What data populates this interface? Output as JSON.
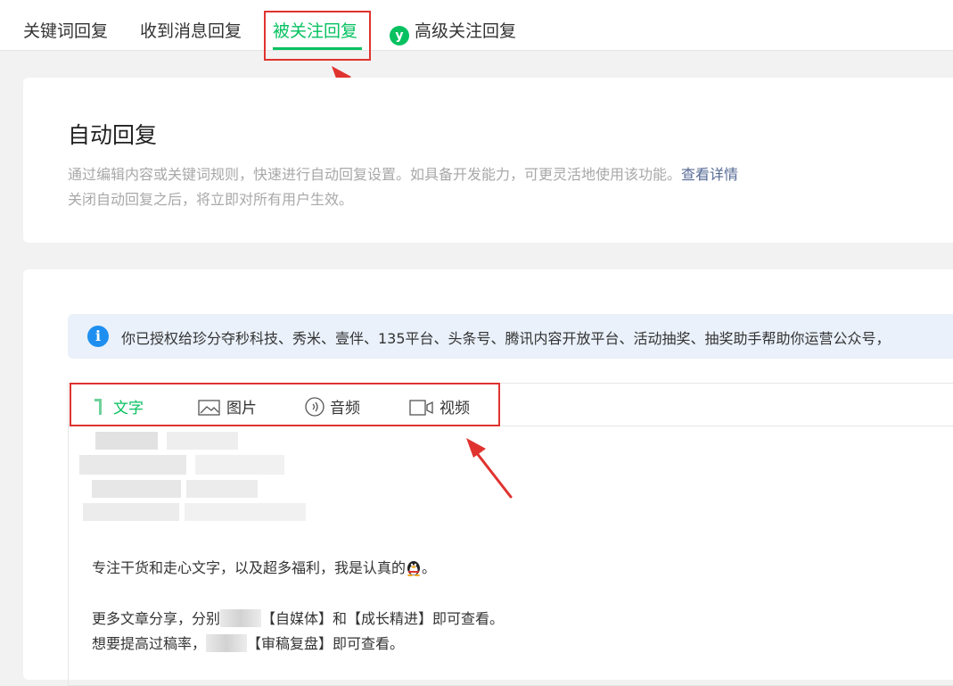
{
  "tabs": [
    {
      "label": "关键词回复",
      "active": false
    },
    {
      "label": "收到消息回复",
      "active": false
    },
    {
      "label": "被关注回复",
      "active": true
    },
    {
      "label": "高级关注回复",
      "active": false,
      "badge": "y"
    }
  ],
  "section": {
    "title": "自动回复",
    "desc_line1": "通过编辑内容或关键词规则，快速进行自动回复设置。如具备开发能力，可更灵活地使用该功能。",
    "desc_link": "查看详情",
    "desc_line2": "关闭自动回复之后，将立即对所有用户生效。"
  },
  "notice": {
    "icon": "i",
    "text": "你已授权给珍分夺秒科技、秀米、壹伴、135平台、头条号、腾讯内容开放平台、活动抽奖、抽奖助手帮助你运营公众号，"
  },
  "editor_tabs": [
    {
      "label": "文字",
      "icon": "text-icon",
      "active": true
    },
    {
      "label": "图片",
      "icon": "image-icon",
      "active": false
    },
    {
      "label": "音频",
      "icon": "audio-icon",
      "active": false
    },
    {
      "label": "视频",
      "icon": "video-icon",
      "active": false
    }
  ],
  "reply": {
    "line1_pre": "专注干货和走心文字，以及超多福利，我是认真的",
    "line1_post": "。",
    "line2_pre": "更多文章分享，分别",
    "line2_post": "【自媒体】和【成长精进】即可查看。",
    "line3_pre": "想要提高过稿率，",
    "line3_post": "【审稿复盘】即可查看。"
  },
  "colors": {
    "accent": "#07c160",
    "highlight": "#e0332f",
    "link": "#576b95",
    "info": "#1e8ff0",
    "notice_bg": "#eaf1fb"
  }
}
